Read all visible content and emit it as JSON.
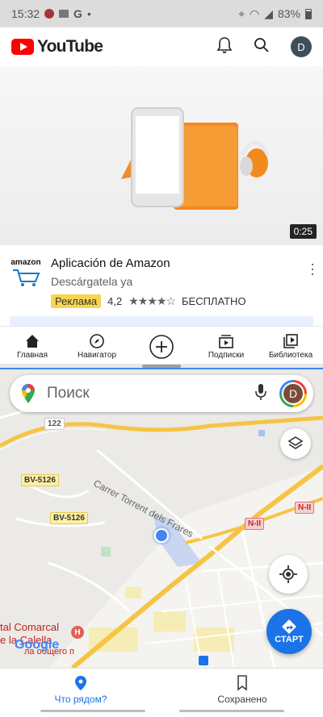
{
  "status_bar": {
    "time": "15:32",
    "battery": "83%"
  },
  "youtube": {
    "logo_text": "YouTube",
    "avatar_letter": "D",
    "video": {
      "duration": "0:25"
    },
    "ad": {
      "title": "Aplicación de Amazon",
      "subtitle": "Descárgatela ya",
      "badge": "Реклама",
      "rating": "4,2",
      "stars": "★★★★☆",
      "price": "БЕСПЛАТНО",
      "logo_text": "amazon"
    },
    "nav": {
      "home": "Главная",
      "explore": "Навигатор",
      "subscriptions": "Подписки",
      "library": "Библиотека"
    }
  },
  "maps": {
    "search_placeholder": "Поиск",
    "avatar_letter": "D",
    "go_label": "СТАРТ",
    "road_labels": {
      "r122": "122",
      "bv5126a": "BV-5126",
      "bv5126b": "BV-5126",
      "n2a": "N-II",
      "n2b": "N-II"
    },
    "street_name": "Carrer Torrent dels Frares",
    "poi_hospital": "tal Comarcal",
    "poi_calella_1": "e la Calella",
    "poi_calella_2": "ла общего п",
    "google_logo": "Google",
    "bottom_nav": {
      "explore": "Что рядом?",
      "saved": "Сохранено"
    }
  },
  "colors": {
    "youtube_red": "#ff0000",
    "ad_badge": "#f9d44d",
    "maps_blue": "#1a73e8",
    "major_road": "#f6c445"
  }
}
